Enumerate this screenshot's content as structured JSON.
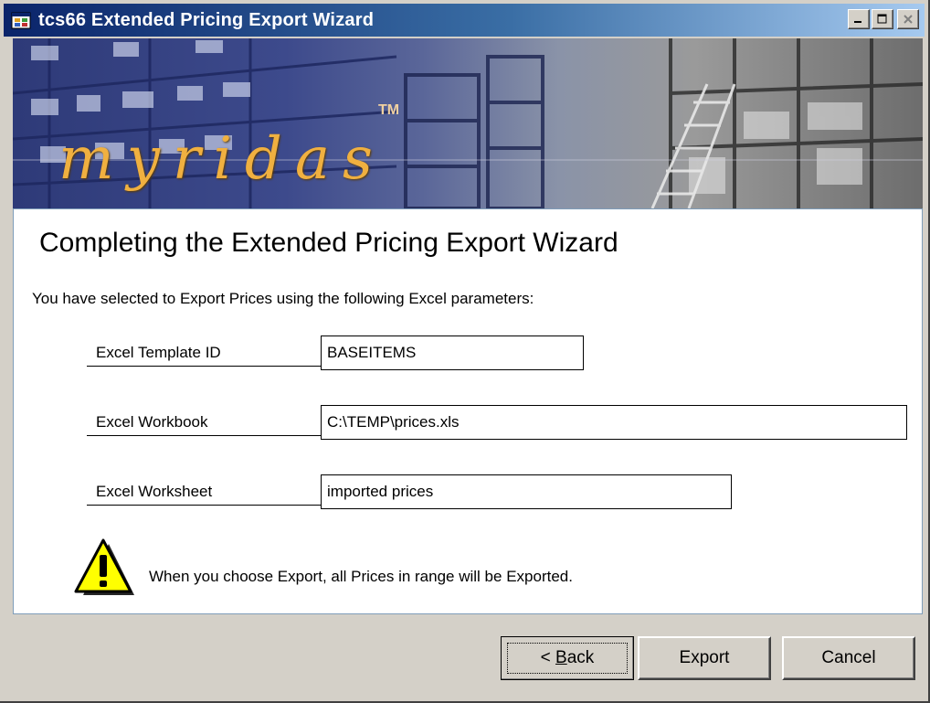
{
  "window": {
    "title": "tcs66 Extended Pricing Export Wizard"
  },
  "banner": {
    "logo": "myridas",
    "trademark": "TM"
  },
  "content": {
    "heading": "Completing the Extended Pricing Export Wizard",
    "intro": "You have selected to Export Prices using the following Excel parameters:",
    "params": [
      {
        "label": "Excel Template ID",
        "value": "BASEITEMS"
      },
      {
        "label": "Excel Workbook",
        "value": "C:\\TEMP\\prices.xls"
      },
      {
        "label": "Excel Worksheet",
        "value": "imported prices"
      }
    ],
    "warning": "When you choose Export, all Prices in range will be Exported."
  },
  "buttons": {
    "back_prefix": "< ",
    "back_mnemonic": "B",
    "back_rest": "ack",
    "export": "Export",
    "cancel": "Cancel"
  },
  "icons": {
    "app": "app-window-icon",
    "warning": "warning-triangle-icon"
  }
}
